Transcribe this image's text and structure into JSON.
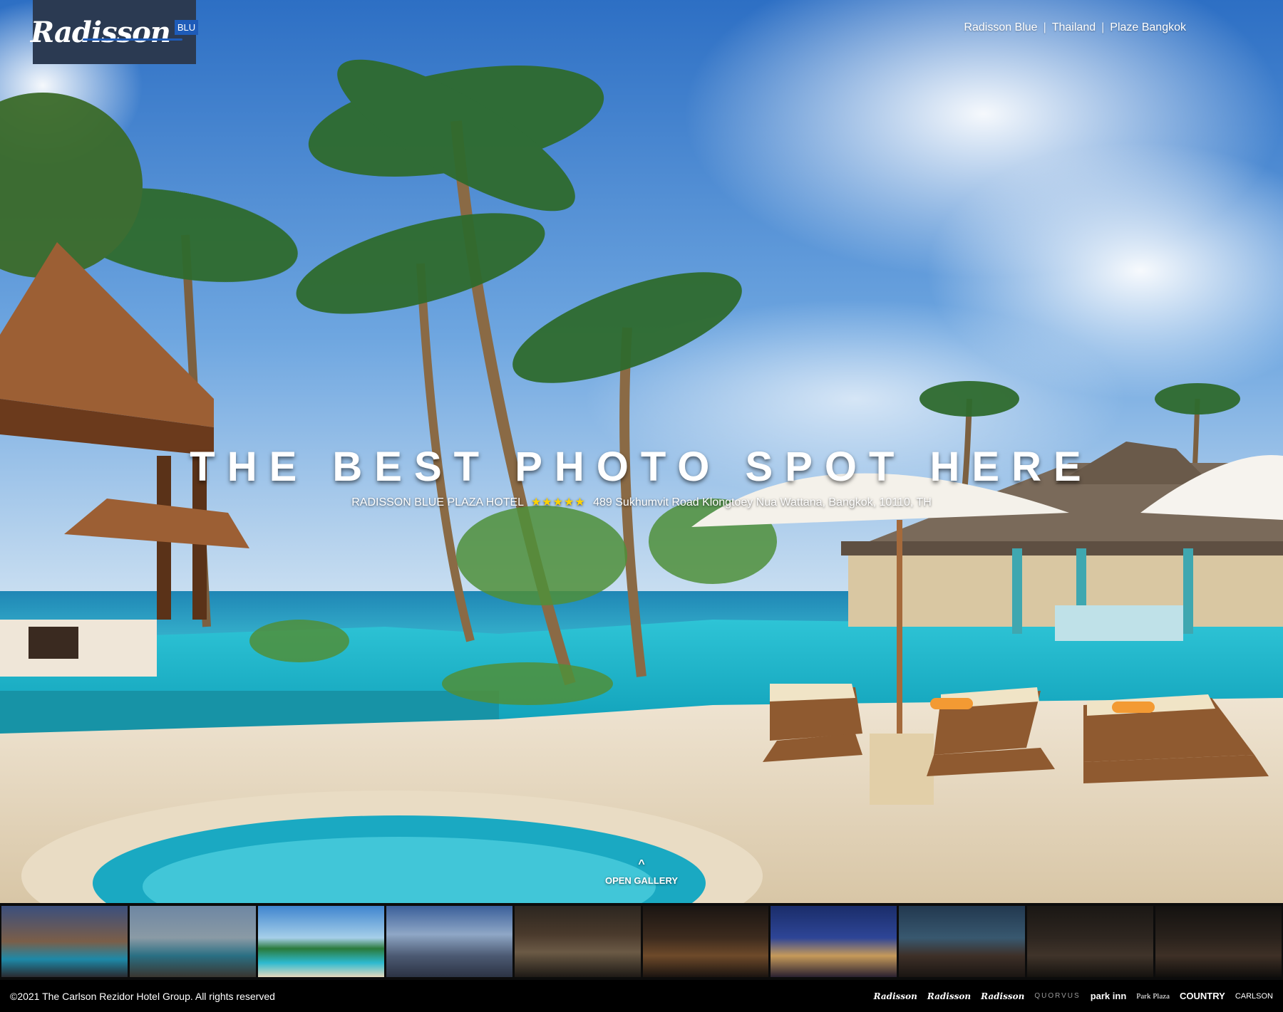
{
  "logo": {
    "wordmark": "Radisson",
    "badge": "BLU"
  },
  "breadcrumb": {
    "items": [
      "Radisson Blue",
      "Thailand",
      "Plaze Bangkok"
    ],
    "separator": "|"
  },
  "hero": {
    "headline": "THE BEST PHOTO SPOT HERE",
    "hotel_name": "RADISSON BLUE PLAZA HOTEL",
    "stars": "★★★★★",
    "star_count": 5,
    "address": "489 Sukhumvit Road Klongtoey Nua Wattana, Bangkok, 10110, TH"
  },
  "gallery": {
    "open_label": "OPEN GALLERY",
    "caret": "^",
    "thumbnail_count": 10
  },
  "footer": {
    "copyright": "©2021 The Carlson Rezidor Hotel Group. All rights reserved",
    "brands": [
      "Radisson",
      "Radisson",
      "Radisson",
      "QUORVUS",
      "park inn",
      "Park Plaza",
      "COUNTRY",
      "CARLSON"
    ]
  },
  "colors": {
    "sky": "#2f77c9",
    "pool": "#1fb5c9",
    "star": "#ffd200",
    "logo_bg": "#2b3a52",
    "logo_accent": "#1e5bb8"
  }
}
